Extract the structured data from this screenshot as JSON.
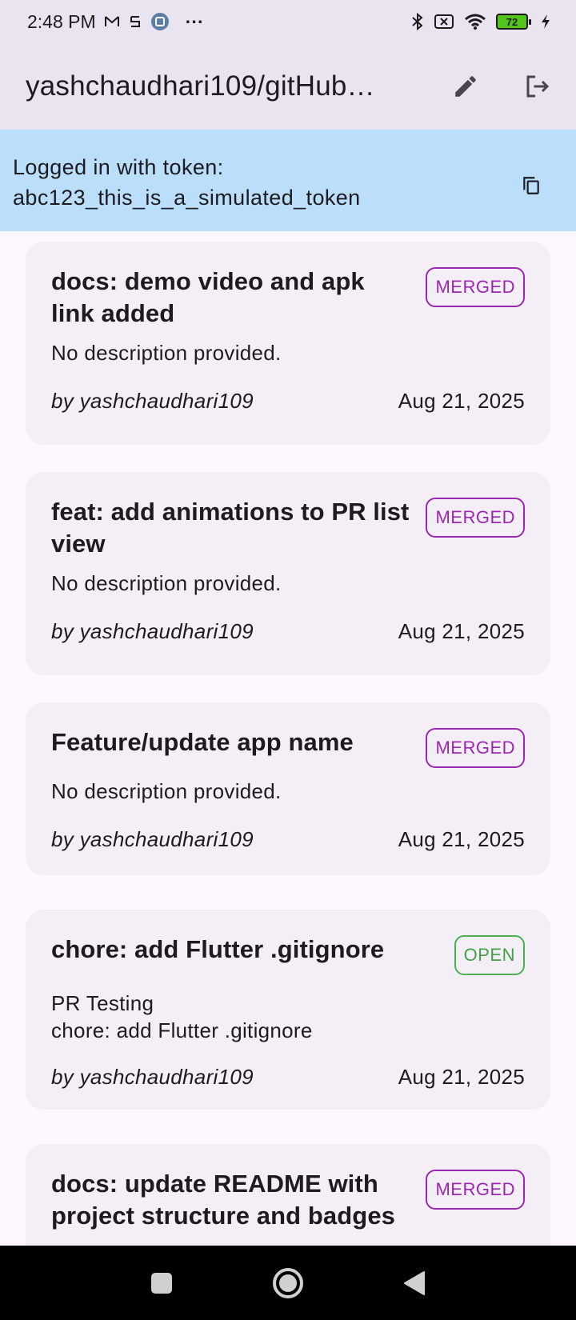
{
  "status_bar": {
    "time": "2:48 PM",
    "battery": "72",
    "more": "···"
  },
  "app_bar": {
    "title": "yashchaudhari109/gitHub…"
  },
  "token_banner": {
    "line1": "Logged in with token:",
    "line2": "abc123_this_is_a_simulated_token"
  },
  "pull_requests": [
    {
      "title": "docs: demo video and apk link added",
      "status": "MERGED",
      "description": "No description provided.",
      "author": "by yashchaudhari109",
      "date": "Aug 21, 2025"
    },
    {
      "title": "feat: add animations to PR list view",
      "status": "MERGED",
      "description": "No description provided.",
      "author": "by yashchaudhari109",
      "date": "Aug 21, 2025"
    },
    {
      "title": "Feature/update app name",
      "status": "MERGED",
      "description": "No description provided.",
      "author": "by yashchaudhari109",
      "date": "Aug 21, 2025"
    },
    {
      "title": "chore: add Flutter .gitignore",
      "status": "OPEN",
      "description": "PR Testing\nchore: add Flutter .gitignore",
      "author": "by yashchaudhari109",
      "date": "Aug 21, 2025"
    },
    {
      "title": "docs: update README with project structure and badges",
      "status": "MERGED",
      "description": "",
      "author": "",
      "date": ""
    }
  ],
  "colors": {
    "merged": "#9c27b0",
    "open": "#43a047",
    "banner": "#bbdefb",
    "app_bar": "#e9e4ef",
    "card": "#f4eff7"
  }
}
